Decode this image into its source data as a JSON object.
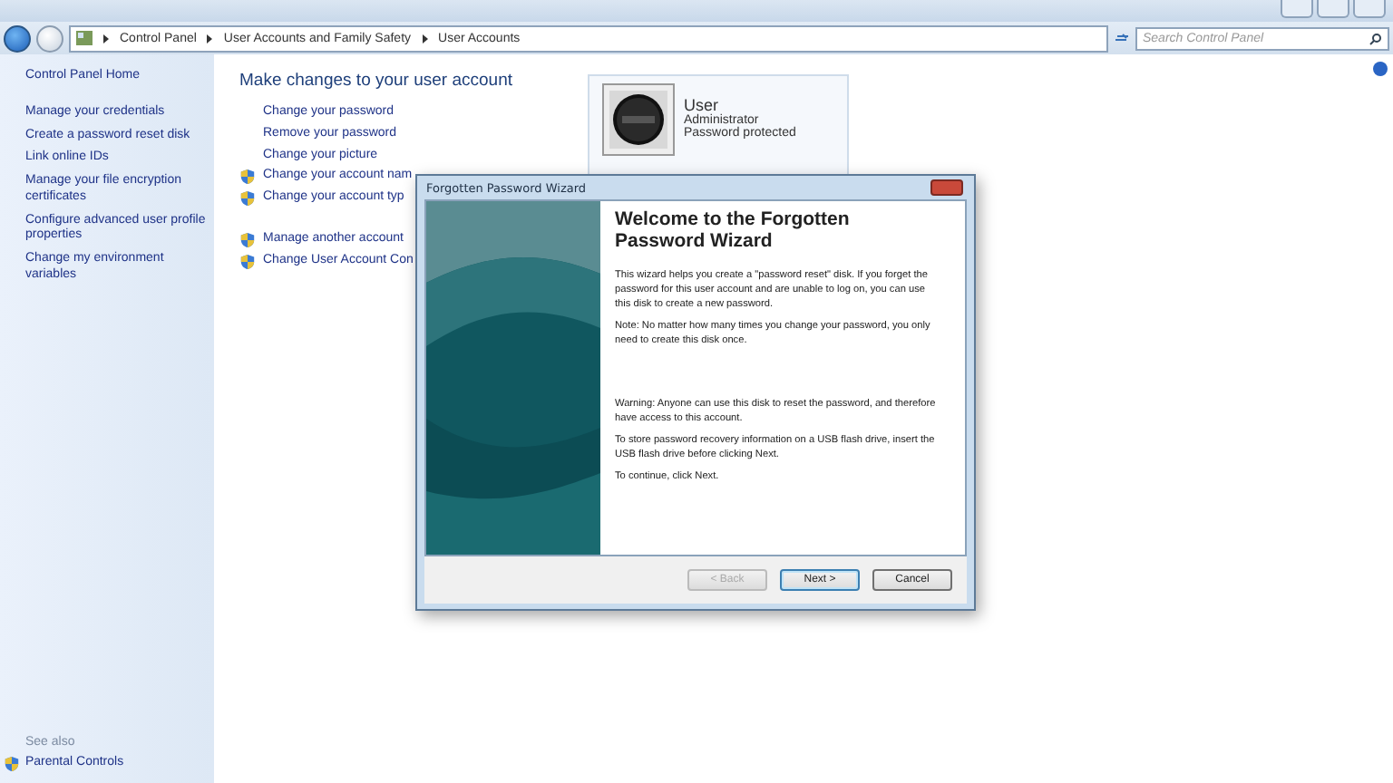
{
  "breadcrumb": [
    "Control Panel",
    "User Accounts and Family Safety",
    "User Accounts"
  ],
  "search": {
    "placeholder": "Search Control Panel"
  },
  "sidebar": {
    "items": [
      {
        "label": "Control Panel Home"
      },
      {
        "label": "Manage your credentials"
      },
      {
        "label": "Create a password reset disk"
      },
      {
        "label": "Link online IDs"
      },
      {
        "label": "Manage your file encryption certificates"
      },
      {
        "label": "Configure advanced user profile properties"
      },
      {
        "label": "Change my environment variables"
      }
    ],
    "see_also": {
      "heading": "See also",
      "items": [
        {
          "label": "Parental Controls",
          "shield": true
        }
      ]
    }
  },
  "main": {
    "heading": "Make changes to your user account",
    "groups": [
      [
        {
          "label": "Change your password",
          "shield": false
        },
        {
          "label": "Remove your password",
          "shield": false
        },
        {
          "label": "Change your picture",
          "shield": false
        },
        {
          "label": "Change your account nam",
          "shield": true
        },
        {
          "label": "Change your account typ",
          "shield": true
        }
      ],
      [
        {
          "label": "Manage another account",
          "shield": true
        },
        {
          "label": "Change User Account Con",
          "shield": true
        }
      ]
    ],
    "user": {
      "name": "User",
      "role": "Administrator",
      "status": "Password protected"
    }
  },
  "dialog": {
    "title": "Forgotten Password Wizard",
    "heading": "Welcome to the Forgotten Password Wizard",
    "paragraphs": [
      {
        "text": "This wizard helps you create a \"password reset\" disk. If you forget the password for this user account and are unable to log on, you can use this disk to create a new password.",
        "gap_before": false
      },
      {
        "text": "Note: No matter how many times you change your password, you only need to create this disk once.",
        "gap_before": false
      },
      {
        "text": "Warning: Anyone can use this disk to reset the password, and therefore have access to this account.",
        "gap_before": true
      },
      {
        "text": "To store password recovery information on a USB flash drive, insert the USB flash drive before clicking Next.",
        "gap_before": false
      },
      {
        "text": "To continue, click Next.",
        "gap_before": false
      }
    ],
    "buttons": [
      {
        "label": "< Back",
        "disabled": true
      },
      {
        "label": "Next >",
        "disabled": false
      },
      {
        "label": "Cancel",
        "disabled": false
      }
    ]
  }
}
